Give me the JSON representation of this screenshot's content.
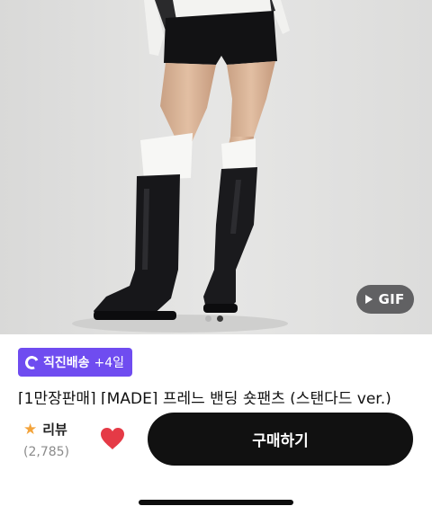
{
  "media": {
    "gif_label": "GIF",
    "slide_count": 2,
    "active_slide": 2
  },
  "delivery": {
    "label": "직진배송",
    "extra": "+4일",
    "color": "#6f4cf0"
  },
  "product": {
    "title": "[1만장판매] [MADE] 프레느 밴딩 숏팬츠 (스탠다드 ver.)"
  },
  "review": {
    "label": "리뷰",
    "count": "(2,785)",
    "icon": "star-icon"
  },
  "actions": {
    "like_icon": "heart-icon",
    "like_color": "#e53a46",
    "buy_label": "구매하기"
  }
}
